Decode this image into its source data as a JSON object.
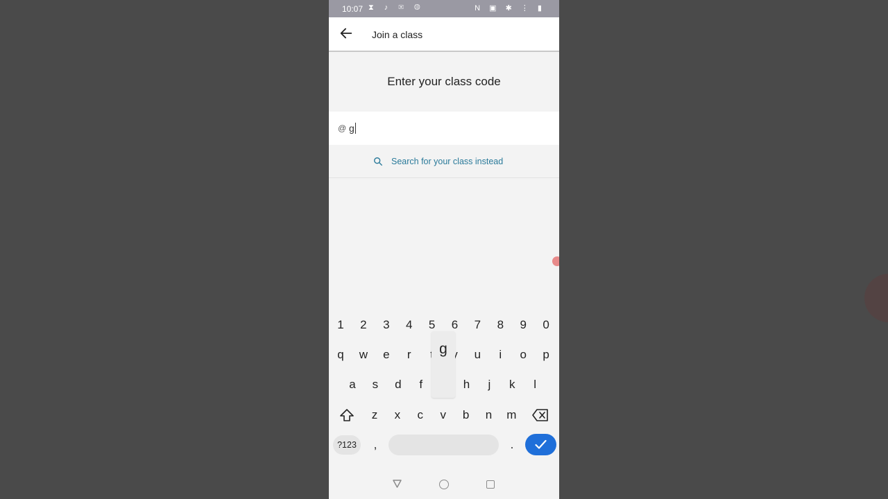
{
  "status": {
    "time": "10:07",
    "left_icons": "⧗ ♪ ✉ ◍",
    "right_icons": "N ▣ ✱ ⋮ ▮"
  },
  "appbar": {
    "title": "Join a class"
  },
  "main": {
    "prompt": "Enter your class code",
    "input_prefix": "@",
    "input_value": "g",
    "search_link": "Search for your class instead"
  },
  "keyboard": {
    "row_numbers": [
      "1",
      "2",
      "3",
      "4",
      "5",
      "6",
      "7",
      "8",
      "9",
      "0"
    ],
    "row_top": [
      "q",
      "w",
      "e",
      "r",
      "t",
      "y",
      "u",
      "i",
      "o",
      "p"
    ],
    "row_middle": [
      "a",
      "s",
      "d",
      "f",
      "g",
      "h",
      "j",
      "k",
      "l"
    ],
    "row_bottom": [
      "z",
      "x",
      "c",
      "v",
      "b",
      "n",
      "m"
    ],
    "popup_key": "g",
    "symbols_label": "?123",
    "comma": ",",
    "period": "."
  },
  "colors": {
    "accent": "#1f6fd9",
    "link": "#2a7a9a",
    "statusbar": "#9a99a3"
  }
}
